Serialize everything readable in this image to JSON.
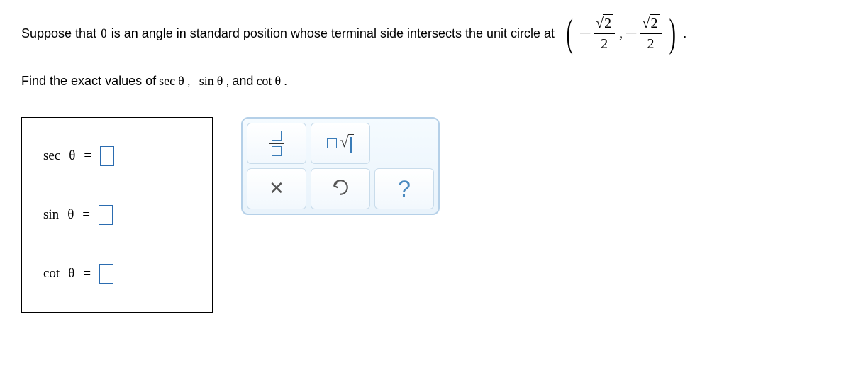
{
  "question": {
    "prefix": "Suppose that ",
    "theta": "θ",
    "mid": " is an angle in standard position whose terminal side intersects the unit circle at ",
    "coord": {
      "x_sign": "−",
      "x_num_radicand": "2",
      "x_den": "2",
      "comma": ",",
      "y_sign": "−",
      "y_num_radicand": "2",
      "y_den": "2"
    },
    "period": "."
  },
  "prompt": {
    "prefix": "Find the exact values of ",
    "f1": "sec",
    "f2": "sin",
    "f3": "cot",
    "theta": "θ",
    "sep": ", ",
    "and": "and ",
    "period": "."
  },
  "answers": {
    "row1_fn": "sec",
    "row2_fn": "sin",
    "row3_fn": "cot",
    "theta": "θ",
    "eq": "="
  },
  "toolbar": {
    "fraction": "fraction",
    "sqrt": "square-root",
    "clear": "clear",
    "undo": "undo",
    "help": "help",
    "help_symbol": "?"
  }
}
